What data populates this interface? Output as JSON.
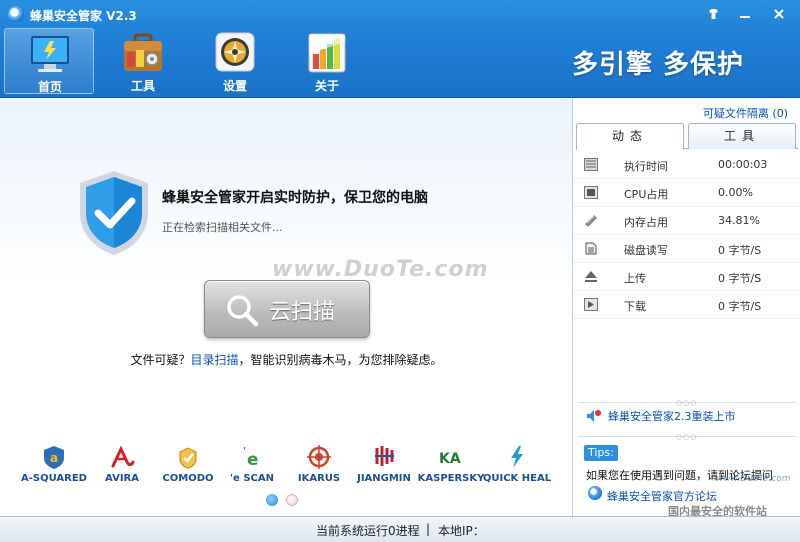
{
  "app": {
    "title": "蜂巢安全管家 V2.3"
  },
  "window_controls": {
    "skin": "skin-icon",
    "minimize": "minimize-icon",
    "close": "close-icon"
  },
  "nav": {
    "items": [
      {
        "label": "首页",
        "icon": "monitor-icon",
        "active": true
      },
      {
        "label": "工具",
        "icon": "toolbox-icon",
        "active": false
      },
      {
        "label": "设置",
        "icon": "settings-icon",
        "active": false
      },
      {
        "label": "关于",
        "icon": "about-icon",
        "active": false
      }
    ]
  },
  "slogan": "多引擎 多保护",
  "main": {
    "status_title": "蜂巢安全管家开启实时防护，保卫您的电脑",
    "status_sub": "正在检索扫描相关文件...",
    "watermark": "www.DuoTe.com",
    "scan_button": "云扫描",
    "hint_prefix": "文件可疑？",
    "hint_link": "目录扫描",
    "hint_suffix": "，智能识别病毒木马，为您排除疑虑。"
  },
  "engines": [
    {
      "name": "A-SQUARED",
      "color": "#2d6db5"
    },
    {
      "name": "AVIRA",
      "color": "#d0202a"
    },
    {
      "name": "COMODO",
      "color": "#d89a20"
    },
    {
      "name": "'e SCAN",
      "color": "#2f9b3a"
    },
    {
      "name": "IKARUS",
      "color": "#d0402a"
    },
    {
      "name": "JIANGMIN",
      "color": "#c02030"
    },
    {
      "name": "KASPERSKY",
      "color": "#1f7a3a"
    },
    {
      "name": "QUICK HEAL",
      "color": "#20a0c8"
    }
  ],
  "carousel": {
    "active_index": 0,
    "count": 2
  },
  "side": {
    "quarantine_link": "可疑文件隔离 (0)",
    "tabs": [
      "动态",
      "工具"
    ],
    "stats": [
      {
        "icon": "clock-icon",
        "label": "执行时间",
        "value": "00:00:03"
      },
      {
        "icon": "cpu-icon",
        "label": "CPU占用",
        "value": "0.00%"
      },
      {
        "icon": "memory-icon",
        "label": "内存占用",
        "value": "34.81%"
      },
      {
        "icon": "disk-icon",
        "label": "磁盘读写",
        "value": "0 字节/S"
      },
      {
        "icon": "upload-icon",
        "label": "上传",
        "value": "0 字节/S"
      },
      {
        "icon": "download-icon",
        "label": "下载",
        "value": "0 字节/S"
      }
    ],
    "news_link": "蜂巢安全管家2.3重装上市",
    "tips_badge": "Tips:",
    "tips_text": "如果您在使用遇到问题，请到论坛提问",
    "forum_link": "蜂巢安全管家官方论坛",
    "site_mark": "国内最安全的软件站",
    "site_mark2": "www.DuoTe.com"
  },
  "statusbar": {
    "processes": "当前系统运行0进程",
    "separator": "|",
    "local_ip": "本地IP："
  },
  "colors": {
    "header": "#1f7fd6",
    "accent_link": "#0a50b4",
    "tips": "#2e8fdc"
  }
}
